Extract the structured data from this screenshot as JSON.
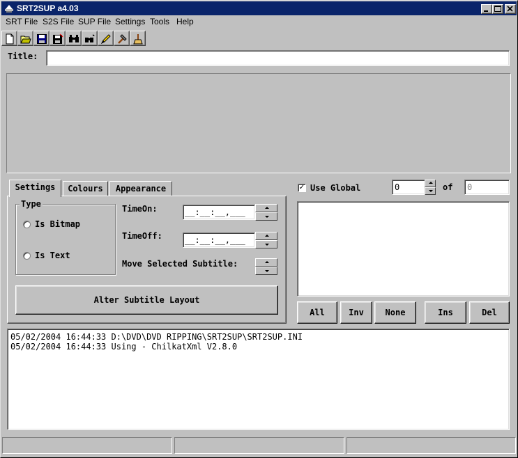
{
  "window": {
    "title": "SRT2SUP a4.03"
  },
  "menu": [
    {
      "label": "SRT File"
    },
    {
      "label": "S2S File"
    },
    {
      "label": "SUP File"
    },
    {
      "label": "Settings"
    },
    {
      "label": "Tools"
    },
    {
      "label": "Help"
    }
  ],
  "toolbar": [
    {
      "icon": "new-file-icon"
    },
    {
      "icon": "open-folder-icon"
    },
    {
      "icon": "save-icon"
    },
    {
      "icon": "save-all-icon"
    },
    {
      "icon": "binoculars-icon"
    },
    {
      "icon": "find-next-icon"
    },
    {
      "icon": "pencil-icon"
    },
    {
      "icon": "hammer-icon"
    },
    {
      "icon": "broom-icon"
    }
  ],
  "title_field": {
    "label": "Title:",
    "value": ""
  },
  "tabs": [
    {
      "label": "Settings",
      "active": true
    },
    {
      "label": "Colours",
      "active": false
    },
    {
      "label": "Appearance",
      "active": false
    }
  ],
  "settings": {
    "type_group_label": "Type",
    "radio_bitmap": "Is Bitmap",
    "radio_text": "Is Text",
    "time_on_label": "TimeOn:",
    "time_on_value": "__:__:__,___",
    "time_off_label": "TimeOff:",
    "time_off_value": "__:__:__,___",
    "move_label": "Move Selected Subtitle:",
    "alter_button": "Alter Subtitle Layout"
  },
  "right_panel": {
    "use_global_label": "Use Global",
    "use_global_checked": true,
    "check_mark": "✓",
    "index_value": "0",
    "of_label": "of",
    "total_value": "0",
    "buttons": [
      "All",
      "Inv",
      "None",
      "Ins",
      "Del"
    ]
  },
  "log": [
    "05/02/2004 16:44:33 D:\\DVD\\DVD RIPPING\\SRT2SUP\\SRT2SUP.INI",
    "05/02/2004 16:44:33 Using - ChilkatXml V2.8.0"
  ],
  "status": [
    "",
    "",
    ""
  ]
}
